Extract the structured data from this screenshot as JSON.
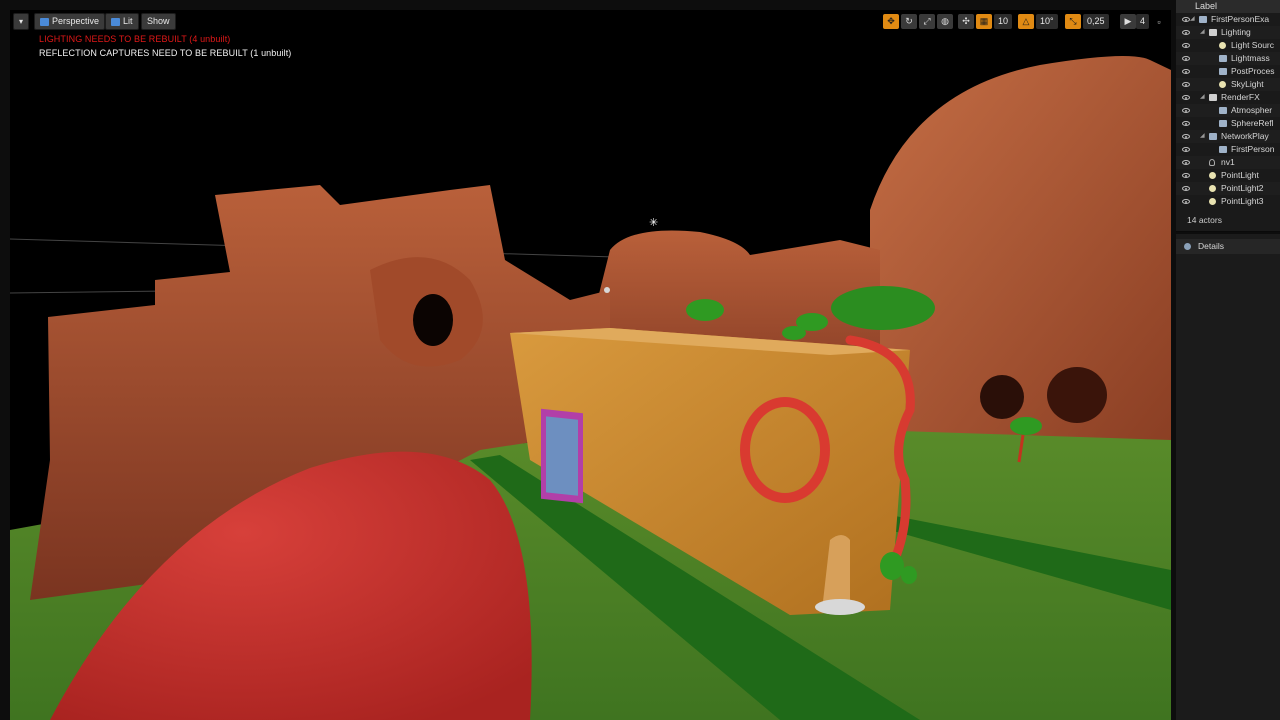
{
  "viewport": {
    "perspective_label": "Perspective",
    "lit_label": "Lit",
    "show_label": "Show",
    "warning_lighting": "LIGHTING NEEDS TO BE REBUILT (4 unbuilt)",
    "warning_reflection": "REFLECTION CAPTURES NEED TO BE REBUILT (1 unbuilt)",
    "grid_snap": "10",
    "rotation_snap": "10°",
    "scale_snap": "0,25",
    "camera_speed": "4"
  },
  "outliner": {
    "header": "Label",
    "rows": [
      {
        "label": "FirstPersonExa",
        "indent": 0,
        "icon": "map-icon",
        "arrow": true
      },
      {
        "label": "Lighting",
        "indent": 1,
        "icon": "folder-icon",
        "arrow": true
      },
      {
        "label": "Light Sourc",
        "indent": 2,
        "icon": "light-icon",
        "arrow": false
      },
      {
        "label": "Lightmass",
        "indent": 2,
        "icon": "actor-icon",
        "arrow": false
      },
      {
        "label": "PostProces",
        "indent": 2,
        "icon": "actor-icon",
        "arrow": false
      },
      {
        "label": "SkyLight",
        "indent": 2,
        "icon": "light-icon",
        "arrow": false
      },
      {
        "label": "RenderFX",
        "indent": 1,
        "icon": "folder-icon",
        "arrow": true
      },
      {
        "label": "Atmospher",
        "indent": 2,
        "icon": "actor-icon",
        "arrow": false
      },
      {
        "label": "SphereRefl",
        "indent": 2,
        "icon": "actor-icon",
        "arrow": false
      },
      {
        "label": "NetworkPlay",
        "indent": 1,
        "icon": "actor-icon",
        "arrow": true
      },
      {
        "label": "FirstPerson",
        "indent": 2,
        "icon": "actor-icon",
        "arrow": false
      },
      {
        "label": "nv1",
        "indent": 1,
        "icon": "pawn-icon",
        "arrow": false
      },
      {
        "label": "PointLight",
        "indent": 1,
        "icon": "light-icon",
        "arrow": false
      },
      {
        "label": "PointLight2",
        "indent": 1,
        "icon": "light-icon",
        "arrow": false
      },
      {
        "label": "PointLight3",
        "indent": 1,
        "icon": "light-icon",
        "arrow": false
      }
    ],
    "actor_count": "14 actors"
  },
  "details": {
    "tab_label": "Details"
  },
  "colors": {
    "warning_red": "#e01818",
    "accent_orange": "#e08a13",
    "lit_blue": "#4a8ad8"
  }
}
